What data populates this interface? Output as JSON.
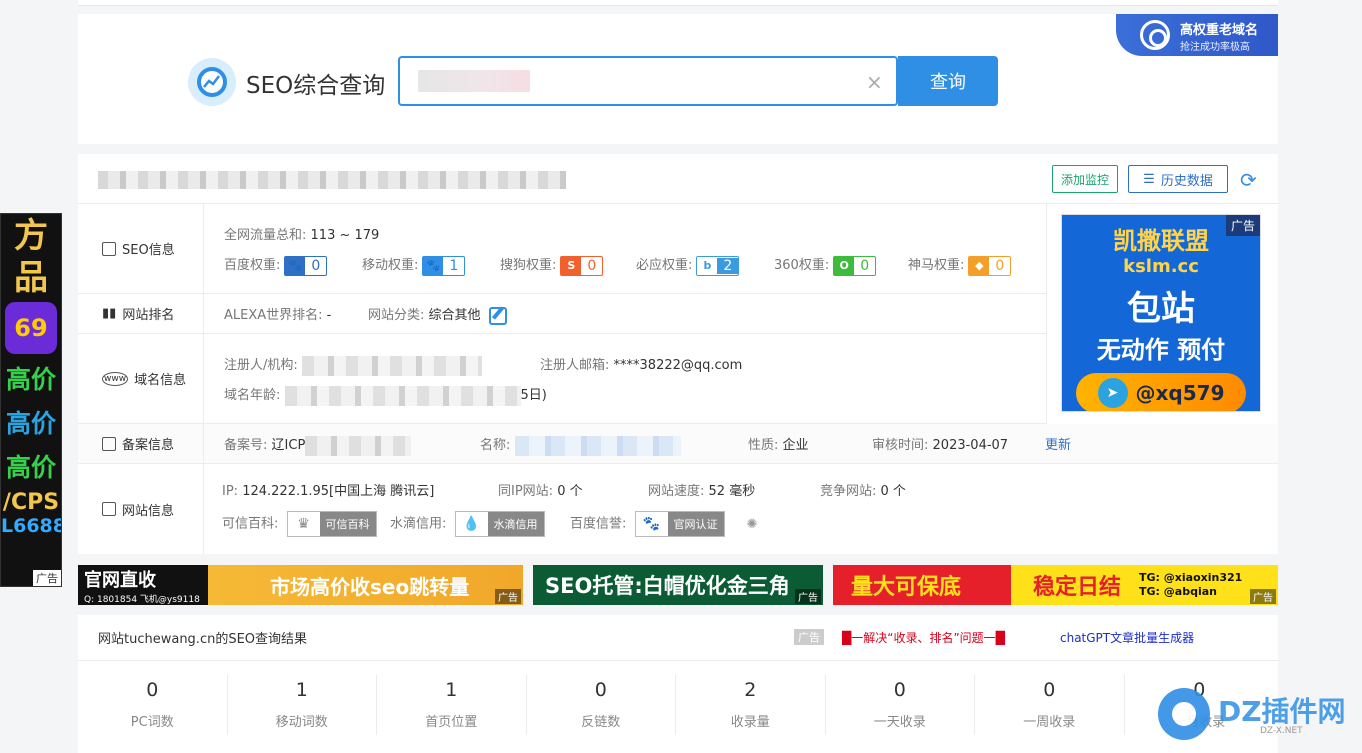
{
  "search": {
    "title": "SEO综合查询",
    "value": "",
    "button": "查询",
    "corner_ad_title": "高权重老域名",
    "corner_ad_sub": "抢注成功率极高"
  },
  "actions": {
    "monitor": "添加监控",
    "history": "历史数据"
  },
  "seo": {
    "label": "SEO信息",
    "traffic_key": "全网流量总和:",
    "traffic_val": "113 ~ 179",
    "weights": [
      {
        "name": "百度权重:",
        "icon": "baidu-paw-icon",
        "value": "0",
        "color": "#2f6fc4"
      },
      {
        "name": "移动权重:",
        "icon": "mobile-paw-icon",
        "value": "1",
        "color": "#2f8fe5"
      },
      {
        "name": "搜狗权重:",
        "icon": "sogou-s-icon",
        "value": "0",
        "color": "#f0612e"
      },
      {
        "name": "必应权重:",
        "icon": "bing-b-icon",
        "value": "2",
        "color": "#3a9be0"
      },
      {
        "name": "360权重:",
        "icon": "360-icon",
        "value": "0",
        "color": "#3dbb3d"
      },
      {
        "name": "神马权重:",
        "icon": "shenma-icon",
        "value": "0",
        "color": "#f3a02a"
      }
    ]
  },
  "rank": {
    "label": "网站排名",
    "alexa_key": "ALEXA世界排名:",
    "alexa_val": "-",
    "cat_key": "网站分类:",
    "cat_val": "综合其他"
  },
  "domain": {
    "label": "域名信息",
    "registrant_key": "注册人/机构:",
    "email_key": "注册人邮箱:",
    "email_val": "****38222@qq.com",
    "age_key": "域名年龄:",
    "age_tail": "5日)"
  },
  "icp": {
    "label": "备案信息",
    "no_key": "备案号:",
    "no_val": "辽ICP",
    "name_key": "名称:",
    "type_key": "性质:",
    "type_val": "企业",
    "audit_key": "审核时间:",
    "audit_val": "2023-04-07",
    "update": "更新"
  },
  "site": {
    "label": "网站信息",
    "ip_key": "IP:",
    "ip_val": "124.222.1.95[中国上海 腾讯云]",
    "sameip_key": "同IP网站:",
    "sameip_val": "0 个",
    "speed_key": "网站速度:",
    "speed_val": "52 毫秒",
    "compete_key": "竞争网站:",
    "compete_val": "0 个",
    "trust_key": "可信百科:",
    "trust_label": "可信百科",
    "water_key": "水滴信用:",
    "water_label": "水滴信用",
    "baidu_key": "百度信誉:",
    "baidu_label": "官网认证"
  },
  "side_ad": {
    "line1": "凯撒联盟",
    "line2": "kslm.cc",
    "line3": "包站",
    "line4": "无动作 预付",
    "contact": "@xq579",
    "tag": "广告"
  },
  "banners": {
    "b1_a": "官网直收",
    "b1_b": "Q: 1801854 飞机@ys9118",
    "b1_main": "市场高价收seo跳转量",
    "b2": "SEO托管:白帽优化金三角",
    "b3_a": "量大可保底",
    "b3_b": "稳定日结",
    "b3_c1": "TG: @xiaoxin321",
    "b3_c2": "TG: @abqian",
    "tag": "广告"
  },
  "results": {
    "title": "网站tuchewang.cn的SEO查询结果",
    "ad_tag": "广告",
    "link1": "█一解决“收录、排名”问题一█",
    "link2": "chatGPT文章批量生成器",
    "stats": [
      {
        "value": "0",
        "label": "PC词数"
      },
      {
        "value": "1",
        "label": "移动词数"
      },
      {
        "value": "1",
        "label": "首页位置"
      },
      {
        "value": "0",
        "label": "反链数"
      },
      {
        "value": "2",
        "label": "收录量"
      },
      {
        "value": "0",
        "label": "一天收录"
      },
      {
        "value": "0",
        "label": "一周收录"
      },
      {
        "value": "0",
        "label": "一月收录"
      }
    ]
  },
  "left_ad": {
    "l1": "方",
    "l2": "品",
    "logo": "69",
    "h1": "高价",
    "h2": "高价",
    "h3": "高价",
    "cps": "/CPS",
    "num": "L6688",
    "tag": "广告"
  },
  "watermark": {
    "text": "DZ插件网",
    "url": "DZ-X.NET"
  }
}
